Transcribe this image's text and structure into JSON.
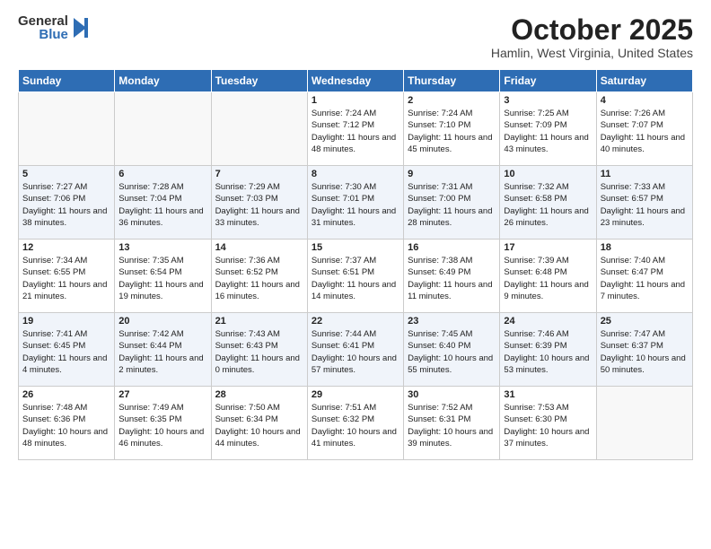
{
  "header": {
    "logo_general": "General",
    "logo_blue": "Blue",
    "month_title": "October 2025",
    "location": "Hamlin, West Virginia, United States"
  },
  "days_of_week": [
    "Sunday",
    "Monday",
    "Tuesday",
    "Wednesday",
    "Thursday",
    "Friday",
    "Saturday"
  ],
  "weeks": [
    [
      {
        "day": "",
        "info": ""
      },
      {
        "day": "",
        "info": ""
      },
      {
        "day": "",
        "info": ""
      },
      {
        "day": "1",
        "info": "Sunrise: 7:24 AM\nSunset: 7:12 PM\nDaylight: 11 hours and 48 minutes."
      },
      {
        "day": "2",
        "info": "Sunrise: 7:24 AM\nSunset: 7:10 PM\nDaylight: 11 hours and 45 minutes."
      },
      {
        "day": "3",
        "info": "Sunrise: 7:25 AM\nSunset: 7:09 PM\nDaylight: 11 hours and 43 minutes."
      },
      {
        "day": "4",
        "info": "Sunrise: 7:26 AM\nSunset: 7:07 PM\nDaylight: 11 hours and 40 minutes."
      }
    ],
    [
      {
        "day": "5",
        "info": "Sunrise: 7:27 AM\nSunset: 7:06 PM\nDaylight: 11 hours and 38 minutes."
      },
      {
        "day": "6",
        "info": "Sunrise: 7:28 AM\nSunset: 7:04 PM\nDaylight: 11 hours and 36 minutes."
      },
      {
        "day": "7",
        "info": "Sunrise: 7:29 AM\nSunset: 7:03 PM\nDaylight: 11 hours and 33 minutes."
      },
      {
        "day": "8",
        "info": "Sunrise: 7:30 AM\nSunset: 7:01 PM\nDaylight: 11 hours and 31 minutes."
      },
      {
        "day": "9",
        "info": "Sunrise: 7:31 AM\nSunset: 7:00 PM\nDaylight: 11 hours and 28 minutes."
      },
      {
        "day": "10",
        "info": "Sunrise: 7:32 AM\nSunset: 6:58 PM\nDaylight: 11 hours and 26 minutes."
      },
      {
        "day": "11",
        "info": "Sunrise: 7:33 AM\nSunset: 6:57 PM\nDaylight: 11 hours and 23 minutes."
      }
    ],
    [
      {
        "day": "12",
        "info": "Sunrise: 7:34 AM\nSunset: 6:55 PM\nDaylight: 11 hours and 21 minutes."
      },
      {
        "day": "13",
        "info": "Sunrise: 7:35 AM\nSunset: 6:54 PM\nDaylight: 11 hours and 19 minutes."
      },
      {
        "day": "14",
        "info": "Sunrise: 7:36 AM\nSunset: 6:52 PM\nDaylight: 11 hours and 16 minutes."
      },
      {
        "day": "15",
        "info": "Sunrise: 7:37 AM\nSunset: 6:51 PM\nDaylight: 11 hours and 14 minutes."
      },
      {
        "day": "16",
        "info": "Sunrise: 7:38 AM\nSunset: 6:49 PM\nDaylight: 11 hours and 11 minutes."
      },
      {
        "day": "17",
        "info": "Sunrise: 7:39 AM\nSunset: 6:48 PM\nDaylight: 11 hours and 9 minutes."
      },
      {
        "day": "18",
        "info": "Sunrise: 7:40 AM\nSunset: 6:47 PM\nDaylight: 11 hours and 7 minutes."
      }
    ],
    [
      {
        "day": "19",
        "info": "Sunrise: 7:41 AM\nSunset: 6:45 PM\nDaylight: 11 hours and 4 minutes."
      },
      {
        "day": "20",
        "info": "Sunrise: 7:42 AM\nSunset: 6:44 PM\nDaylight: 11 hours and 2 minutes."
      },
      {
        "day": "21",
        "info": "Sunrise: 7:43 AM\nSunset: 6:43 PM\nDaylight: 11 hours and 0 minutes."
      },
      {
        "day": "22",
        "info": "Sunrise: 7:44 AM\nSunset: 6:41 PM\nDaylight: 10 hours and 57 minutes."
      },
      {
        "day": "23",
        "info": "Sunrise: 7:45 AM\nSunset: 6:40 PM\nDaylight: 10 hours and 55 minutes."
      },
      {
        "day": "24",
        "info": "Sunrise: 7:46 AM\nSunset: 6:39 PM\nDaylight: 10 hours and 53 minutes."
      },
      {
        "day": "25",
        "info": "Sunrise: 7:47 AM\nSunset: 6:37 PM\nDaylight: 10 hours and 50 minutes."
      }
    ],
    [
      {
        "day": "26",
        "info": "Sunrise: 7:48 AM\nSunset: 6:36 PM\nDaylight: 10 hours and 48 minutes."
      },
      {
        "day": "27",
        "info": "Sunrise: 7:49 AM\nSunset: 6:35 PM\nDaylight: 10 hours and 46 minutes."
      },
      {
        "day": "28",
        "info": "Sunrise: 7:50 AM\nSunset: 6:34 PM\nDaylight: 10 hours and 44 minutes."
      },
      {
        "day": "29",
        "info": "Sunrise: 7:51 AM\nSunset: 6:32 PM\nDaylight: 10 hours and 41 minutes."
      },
      {
        "day": "30",
        "info": "Sunrise: 7:52 AM\nSunset: 6:31 PM\nDaylight: 10 hours and 39 minutes."
      },
      {
        "day": "31",
        "info": "Sunrise: 7:53 AM\nSunset: 6:30 PM\nDaylight: 10 hours and 37 minutes."
      },
      {
        "day": "",
        "info": ""
      }
    ]
  ]
}
